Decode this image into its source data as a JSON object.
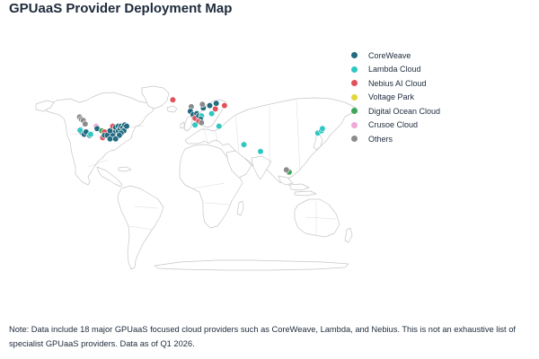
{
  "title": "GPUaaS Provider Deployment Map",
  "legend": [
    {
      "label": "CoreWeave",
      "color": "#226a80"
    },
    {
      "label": "Lambda Cloud",
      "color": "#2fc7c2"
    },
    {
      "label": "Nebius AI Cloud",
      "color": "#e0515b"
    },
    {
      "label": "Voltage Park",
      "color": "#e3d63a"
    },
    {
      "label": "Digital Ocean Cloud",
      "color": "#3fa65b"
    },
    {
      "label": "Crusoe Cloud",
      "color": "#efaad8"
    },
    {
      "label": "Others",
      "color": "#8b8b8b"
    }
  ],
  "note": "Note: Data include 18 major GPUaaS focused cloud providers such as CoreWeave, Lambda, and Nebius. This is not an exhaustive list of specialist GPUaaS providers. Data as of Q1 2026.",
  "map_data": {
    "projection": "equirectangular",
    "markers": [
      {
        "provider": "Others",
        "lon": -123,
        "lat": 49
      },
      {
        "provider": "Others",
        "lon": -121,
        "lat": 47
      },
      {
        "provider": "Others",
        "lon": -119,
        "lat": 46
      },
      {
        "provider": "Others",
        "lon": -117,
        "lat": 43
      },
      {
        "provider": "CoreWeave",
        "lon": -122,
        "lat": 38
      },
      {
        "provider": "CoreWeave",
        "lon": -121,
        "lat": 36
      },
      {
        "provider": "Lambda Cloud",
        "lon": -122.5,
        "lat": 37.5
      },
      {
        "provider": "CoreWeave",
        "lon": -118,
        "lat": 34
      },
      {
        "provider": "CoreWeave",
        "lon": -116,
        "lat": 36
      },
      {
        "provider": "CoreWeave",
        "lon": -112,
        "lat": 33
      },
      {
        "provider": "Lambda Cloud",
        "lon": -111,
        "lat": 34
      },
      {
        "provider": "Crusoe Cloud",
        "lon": -105,
        "lat": 41
      },
      {
        "provider": "CoreWeave",
        "lon": -104,
        "lat": 39
      },
      {
        "provider": "Digital Ocean Cloud",
        "lon": -99,
        "lat": 37
      },
      {
        "provider": "Nebius AI Cloud",
        "lon": -96,
        "lat": 36
      },
      {
        "provider": "Nebius AI Cloud",
        "lon": -98,
        "lat": 31
      },
      {
        "provider": "CoreWeave",
        "lon": -96,
        "lat": 33
      },
      {
        "provider": "CoreWeave",
        "lon": -93,
        "lat": 33
      },
      {
        "provider": "CoreWeave",
        "lon": -90,
        "lat": 30
      },
      {
        "provider": "CoreWeave",
        "lon": -87,
        "lat": 34
      },
      {
        "provider": "CoreWeave",
        "lon": -90,
        "lat": 37
      },
      {
        "provider": "Nebius AI Cloud",
        "lon": -87,
        "lat": 41
      },
      {
        "provider": "CoreWeave",
        "lon": -84,
        "lat": 37
      },
      {
        "provider": "CoreWeave",
        "lon": -84,
        "lat": 40
      },
      {
        "provider": "CoreWeave",
        "lon": -81,
        "lat": 41
      },
      {
        "provider": "CoreWeave",
        "lon": -81,
        "lat": 37
      },
      {
        "provider": "CoreWeave",
        "lon": -79,
        "lat": 39
      },
      {
        "provider": "CoreWeave",
        "lon": -78,
        "lat": 41
      },
      {
        "provider": "CoreWeave",
        "lon": -76,
        "lat": 40
      },
      {
        "provider": "CoreWeave",
        "lon": -75,
        "lat": 37
      },
      {
        "provider": "CoreWeave",
        "lon": -74,
        "lat": 42
      },
      {
        "provider": "CoreWeave",
        "lon": -72,
        "lat": 41
      },
      {
        "provider": "CoreWeave",
        "lon": -78,
        "lat": 35
      },
      {
        "provider": "CoreWeave",
        "lon": -80,
        "lat": 33
      },
      {
        "provider": "CoreWeave",
        "lon": -84,
        "lat": 30
      },
      {
        "provider": "Nebius AI Cloud",
        "lon": -22,
        "lat": 64
      },
      {
        "provider": "Others",
        "lon": -2,
        "lat": 58
      },
      {
        "provider": "CoreWeave",
        "lon": -3,
        "lat": 54
      },
      {
        "provider": "CoreWeave",
        "lon": 0,
        "lat": 51
      },
      {
        "provider": "CoreWeave",
        "lon": 4,
        "lat": 52
      },
      {
        "provider": "Nebius AI Cloud",
        "lon": 2,
        "lat": 48
      },
      {
        "provider": "CoreWeave",
        "lon": 6,
        "lat": 50
      },
      {
        "provider": "Lambda Cloud",
        "lon": 9,
        "lat": 50
      },
      {
        "provider": "CoreWeave",
        "lon": 8,
        "lat": 47
      },
      {
        "provider": "Nebius AI Cloud",
        "lon": 6,
        "lat": 45
      },
      {
        "provider": "Lambda Cloud",
        "lon": 2,
        "lat": 42
      },
      {
        "provider": "Others",
        "lon": 9,
        "lat": 44
      },
      {
        "provider": "CoreWeave",
        "lon": 11,
        "lat": 57
      },
      {
        "provider": "CoreWeave",
        "lon": 18,
        "lat": 59
      },
      {
        "provider": "Others",
        "lon": 10,
        "lat": 60
      },
      {
        "provider": "CoreWeave",
        "lon": 25,
        "lat": 61
      },
      {
        "provider": "Nebius AI Cloud",
        "lon": 24,
        "lat": 56
      },
      {
        "provider": "Nebius AI Cloud",
        "lon": 34,
        "lat": 59
      },
      {
        "provider": "Lambda Cloud",
        "lon": 20,
        "lat": 52
      },
      {
        "provider": "Lambda Cloud",
        "lon": 28,
        "lat": 41
      },
      {
        "provider": "Lambda Cloud",
        "lon": 55,
        "lat": 25
      },
      {
        "provider": "Lambda Cloud",
        "lon": 73,
        "lat": 19
      },
      {
        "provider": "Lambda Cloud",
        "lon": 135,
        "lat": 35
      },
      {
        "provider": "Lambda Cloud",
        "lon": 139,
        "lat": 37
      },
      {
        "provider": "Lambda Cloud",
        "lon": 140,
        "lat": 39
      },
      {
        "provider": "Digital Ocean Cloud",
        "lon": 104,
        "lat": 1
      },
      {
        "provider": "Others",
        "lon": 101,
        "lat": 3
      }
    ]
  }
}
